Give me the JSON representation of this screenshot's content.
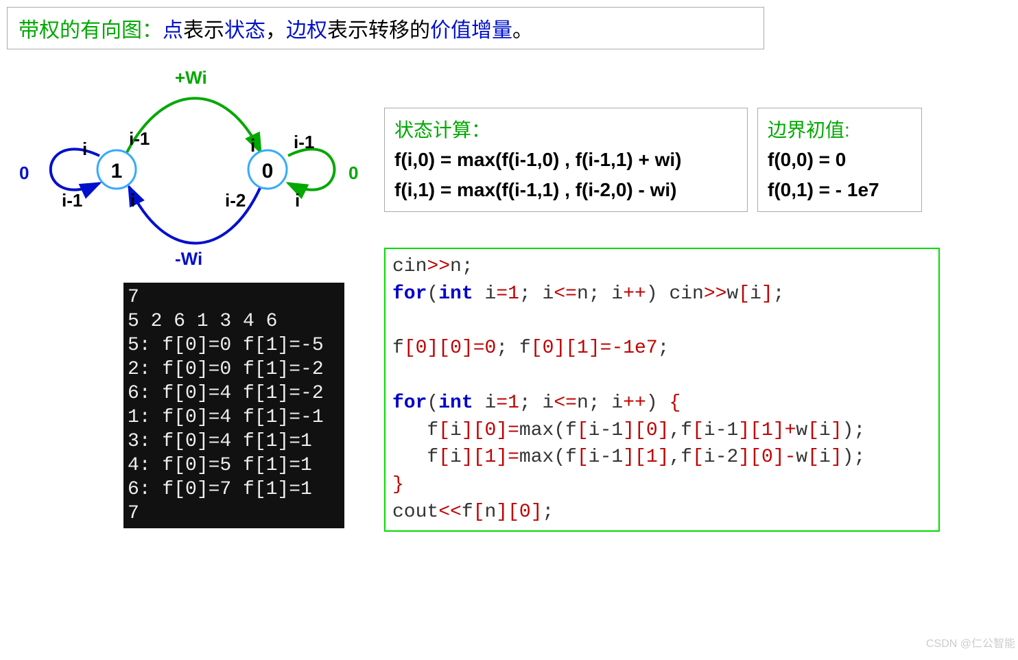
{
  "header": {
    "seg1": "带权的有向图：",
    "seg2": "点",
    "seg3": "表示",
    "seg4": "状态",
    "seg5": "，",
    "seg6": "边权",
    "seg7": "表示转移的",
    "seg8": "价值增量",
    "seg9": "。"
  },
  "diagram": {
    "node1": "1",
    "node0": "0",
    "labelTopPlusWi": "+Wi",
    "labelBotMinusWi": "-Wi",
    "labelLeft0": "0",
    "labelRight0": "0",
    "edge_i_1": "i",
    "edge_i_2": "i-1",
    "edge_i_3": "i-1",
    "edge_i_4": "i",
    "edge_i_5": "i",
    "edge_i_6": "i-1",
    "edge_i_7": "i-2",
    "edge_i_8": "i"
  },
  "stateBox": {
    "title": "状态计算：",
    "line1": "f(i,0) = max(f(i-1,0) , f(i-1,1) + wi)",
    "line2": "f(i,1) = max(f(i-1,1) , f(i-2,0) -  wi)"
  },
  "initBox": {
    "title": "边界初值:",
    "line1": "f(0,0) = 0",
    "line2": "f(0,1) = - 1e7"
  },
  "console": {
    "text": "7\n5 2 6 1 3 4 6\n5: f[0]=0 f[1]=-5\n2: f[0]=0 f[1]=-2\n6: f[0]=4 f[1]=-2\n1: f[0]=4 f[1]=-1\n3: f[0]=4 f[1]=1\n4: f[0]=5 f[1]=1\n6: f[0]=7 f[1]=1\n7"
  },
  "code": {
    "cin": "cin",
    "gtgt": ">>",
    "n": "n",
    "semi": ";",
    "for": "for",
    "int": "int",
    "i": "i",
    "eq": "=",
    "one": "1",
    "le": "<=",
    "pp": "++",
    "lpar": "(",
    "rpar": ")",
    "w": "w",
    "lb": "[",
    "rb": "]",
    "f": "f",
    "zero": "0",
    "neg1e7": "-1e7",
    "lbrace": "{",
    "rbrace": "}",
    "max": "max",
    "comma": ",",
    "im1": "i-1",
    "im2": "i-2",
    "plus": "+",
    "minus": "-",
    "cout": "cout",
    "ltlt": "<<",
    "sp": " ",
    "sp3": "   "
  },
  "watermark": "CSDN @仁公智能"
}
